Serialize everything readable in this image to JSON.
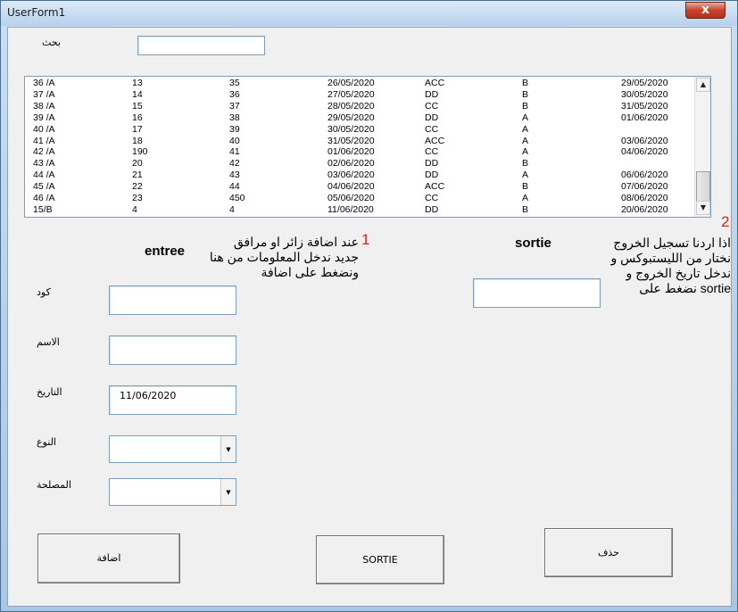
{
  "window": {
    "title": "UserForm1",
    "close_label": "x"
  },
  "search": {
    "label": "بحث",
    "value": ""
  },
  "list": {
    "rows": [
      [
        "36 /A",
        "13",
        "35",
        "26/05/2020",
        "ACC",
        "B",
        "29/05/2020"
      ],
      [
        "37 /A",
        "14",
        "36",
        "27/05/2020",
        "DD",
        "B",
        "30/05/2020"
      ],
      [
        "38 /A",
        "15",
        "37",
        "28/05/2020",
        "CC",
        "B",
        "31/05/2020"
      ],
      [
        "39 /A",
        "16",
        "38",
        "29/05/2020",
        "DD",
        "A",
        "01/06/2020"
      ],
      [
        "40 /A",
        "17",
        "39",
        "30/05/2020",
        "CC",
        "A",
        ""
      ],
      [
        "41 /A",
        "18",
        "40",
        "31/05/2020",
        "ACC",
        "A",
        "03/06/2020"
      ],
      [
        "42 /A",
        "190",
        "41",
        "01/06/2020",
        "CC",
        "A",
        "04/06/2020"
      ],
      [
        "43 /A",
        "20",
        "42",
        "02/06/2020",
        "DD",
        "B",
        ""
      ],
      [
        "44 /A",
        "21",
        "43",
        "03/06/2020",
        "DD",
        "A",
        "06/06/2020"
      ],
      [
        "45 /A",
        "22",
        "44",
        "04/06/2020",
        "ACC",
        "B",
        "07/06/2020"
      ],
      [
        "46 /A",
        "23",
        "450",
        "05/06/2020",
        "CC",
        "A",
        "08/06/2020"
      ],
      [
        "15/B",
        "4",
        "4",
        "11/06/2020",
        "DD",
        "B",
        "20/06/2020"
      ]
    ],
    "scroll_up": "▲",
    "scroll_down": "▼"
  },
  "entree": {
    "heading": "entree",
    "note_number": "1",
    "note_lines": [
      "عند اضافة زائر او مرافق",
      "جديد ندخل المعلومات من هنا",
      "ونضغط على اضافة"
    ],
    "code_label": "كود",
    "code_value": "",
    "name_label": "الاسم",
    "name_value": "",
    "date_label": "التاريخ",
    "date_value": "11/06/2020",
    "type_label": "النوع",
    "type_value": "",
    "service_label": "المصلحة",
    "service_value": "",
    "dropdown_arrow": "▼"
  },
  "sortie": {
    "heading": "sortie",
    "note_number": "2",
    "note_lines": [
      "اذا اردنا تسجيل الخروج",
      "نختار من الليستبوكس و",
      "ندخل تاريخ الخروج و",
      "sortie نضغط على"
    ],
    "date_value": ""
  },
  "buttons": {
    "add": "اضافة",
    "sortie": "SORTIE",
    "delete": "حذف"
  }
}
